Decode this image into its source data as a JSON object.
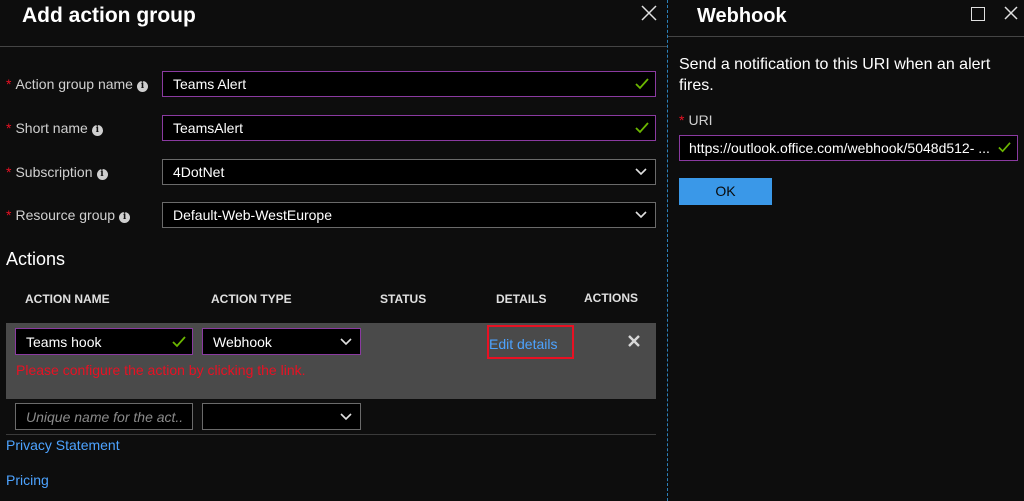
{
  "left_panel": {
    "title": "Add action group",
    "fields": [
      {
        "label": "Action group name",
        "value": "Teams Alert"
      },
      {
        "label": "Short name",
        "value": "TeamsAlert"
      },
      {
        "label": "Subscription",
        "value": "4DotNet"
      },
      {
        "label": "Resource group",
        "value": "Default-Web-WestEurope"
      }
    ],
    "required_mark": "*",
    "info_glyph": "i"
  },
  "actions": {
    "heading": "Actions",
    "columns": {
      "name": "ACTION NAME",
      "type": "ACTION TYPE",
      "status": "STATUS",
      "details": "DETAILS",
      "actions": "ACTIONS"
    },
    "row": {
      "name": "Teams hook",
      "type": "Webhook",
      "edit_link": "Edit details",
      "error": "Please configure the action by clicking the link."
    },
    "new_row": {
      "name_placeholder": "Unique name for the act..."
    }
  },
  "links": {
    "privacy": "Privacy Statement",
    "pricing": "Pricing"
  },
  "right_panel": {
    "title": "Webhook",
    "description": "Send a notification to this URI when an alert fires.",
    "uri_label": "URI",
    "uri_value": "https://outlook.office.com/webhook/5048d512- ...",
    "ok_label": "OK"
  },
  "colors": {
    "accent_blue": "#3a98e8",
    "link_blue": "#4da3ff",
    "error_red": "#e81123",
    "valid_green": "#6bb700",
    "focus_purple": "#8a3aa0"
  }
}
